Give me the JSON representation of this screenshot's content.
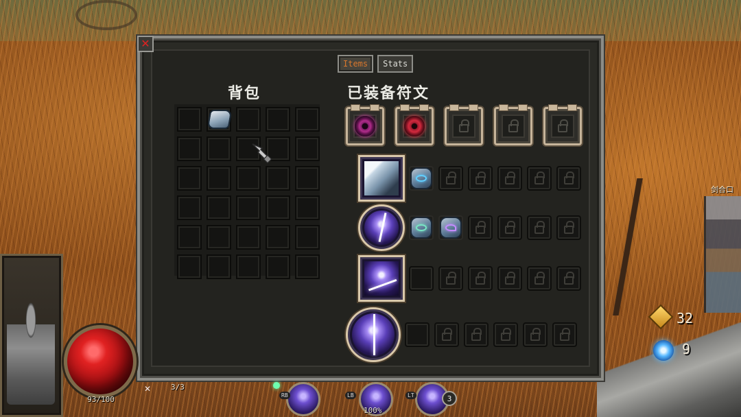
{
  "panel": {
    "close_icon": "close-x-icon",
    "tabs": [
      {
        "label": "Items",
        "active": true
      },
      {
        "label": "Stats",
        "active": false
      }
    ],
    "backpack_title": "背包",
    "runes_title": "已装备符文",
    "backpack": {
      "columns": 5,
      "rows": 6,
      "filled_slots": [
        {
          "index": 1,
          "item": "crystal-ore-gem"
        }
      ]
    },
    "equipped_runes": [
      {
        "slot": 1,
        "state": "filled",
        "icon": "purple-vortex-rune-icon"
      },
      {
        "slot": 2,
        "state": "filled",
        "icon": "red-vortex-rune-icon"
      },
      {
        "slot": 3,
        "state": "locked",
        "icon": "lock-icon"
      },
      {
        "slot": 4,
        "state": "locked",
        "icon": "lock-icon"
      },
      {
        "slot": 5,
        "state": "locked",
        "icon": "lock-icon"
      }
    ],
    "skills": [
      {
        "icon": "ice-crystal-skill-icon",
        "shape": "square",
        "subslots": [
          "gem-blue",
          "locked",
          "locked",
          "locked",
          "locked",
          "locked"
        ]
      },
      {
        "icon": "lightning-orb-skill-icon",
        "shape": "round",
        "subslots": [
          "gem-green",
          "gem-violet",
          "locked",
          "locked",
          "locked",
          "locked"
        ]
      },
      {
        "icon": "lightning-burst-skill-icon",
        "shape": "square",
        "subslots": [
          "empty",
          "locked",
          "locked",
          "locked",
          "locked",
          "locked"
        ]
      },
      {
        "icon": "lightning-pillar-skill-icon",
        "shape": "round-big",
        "subslots": [
          "empty",
          "locked",
          "locked",
          "locked",
          "locked",
          "locked"
        ]
      }
    ]
  },
  "hud": {
    "hp": "93/100",
    "charges": "3/3",
    "hotbar": {
      "buttons": [
        "RB",
        "LB",
        "LT"
      ],
      "count": "3"
    },
    "zoom": "100%",
    "gold": "32",
    "souls": "9",
    "side_label": "剑合口",
    "health_orb_color": "#e12222"
  }
}
